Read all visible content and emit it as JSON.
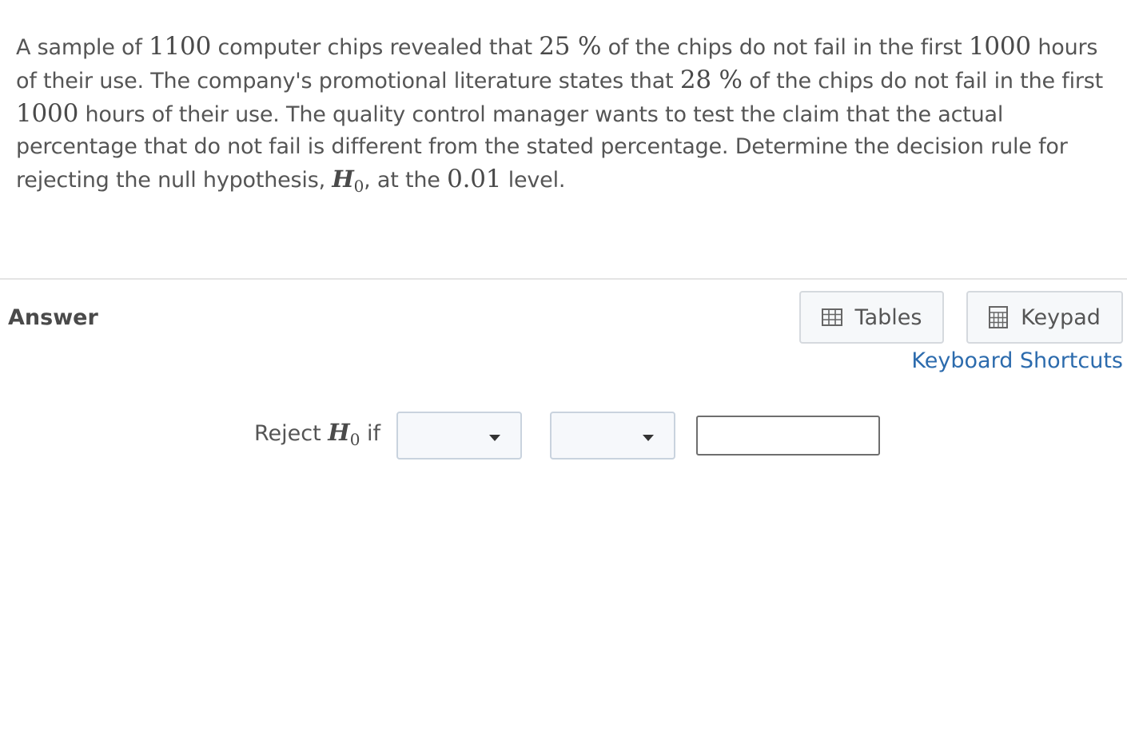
{
  "question": {
    "t1": "A sample of ",
    "n_chips": "1100",
    "t2": " computer chips revealed that ",
    "pct_observed": "25 %",
    "t3": " of the chips do not fail in the first ",
    "hours_1": "1000",
    "t4": " hours of their use.  The company's promotional literature states that ",
    "pct_claimed": "28 %",
    "t5": " of the chips do not fail in the first ",
    "hours_2": "1000",
    "t6": " hours of their use.  The quality control manager wants to test the claim that the actual percentage that do not fail is different from the stated percentage.  Determine the decision rule for rejecting the null hypothesis, ",
    "h_symbol": "H",
    "h_sub": "0",
    "t7": ", at the ",
    "alpha": "0.01",
    "t8": " level."
  },
  "answer": {
    "label": "Answer",
    "tables_label": "Tables",
    "keypad_label": "Keypad",
    "shortcuts_label": "Keyboard Shortcuts",
    "reject_prefix": "Reject ",
    "h_symbol": "H",
    "h_sub": "0",
    "reject_suffix": " if",
    "dropdown_1_value": "",
    "dropdown_2_value": "",
    "input_value": ""
  },
  "icons": {
    "tables": "table-grid-icon",
    "keypad": "calculator-icon",
    "dropdown": "caret-down-icon"
  },
  "colors": {
    "text": "#555555",
    "link": "#2c6bad",
    "button_border": "#d5d9de",
    "dropdown_bg": "#f6f8fb"
  }
}
